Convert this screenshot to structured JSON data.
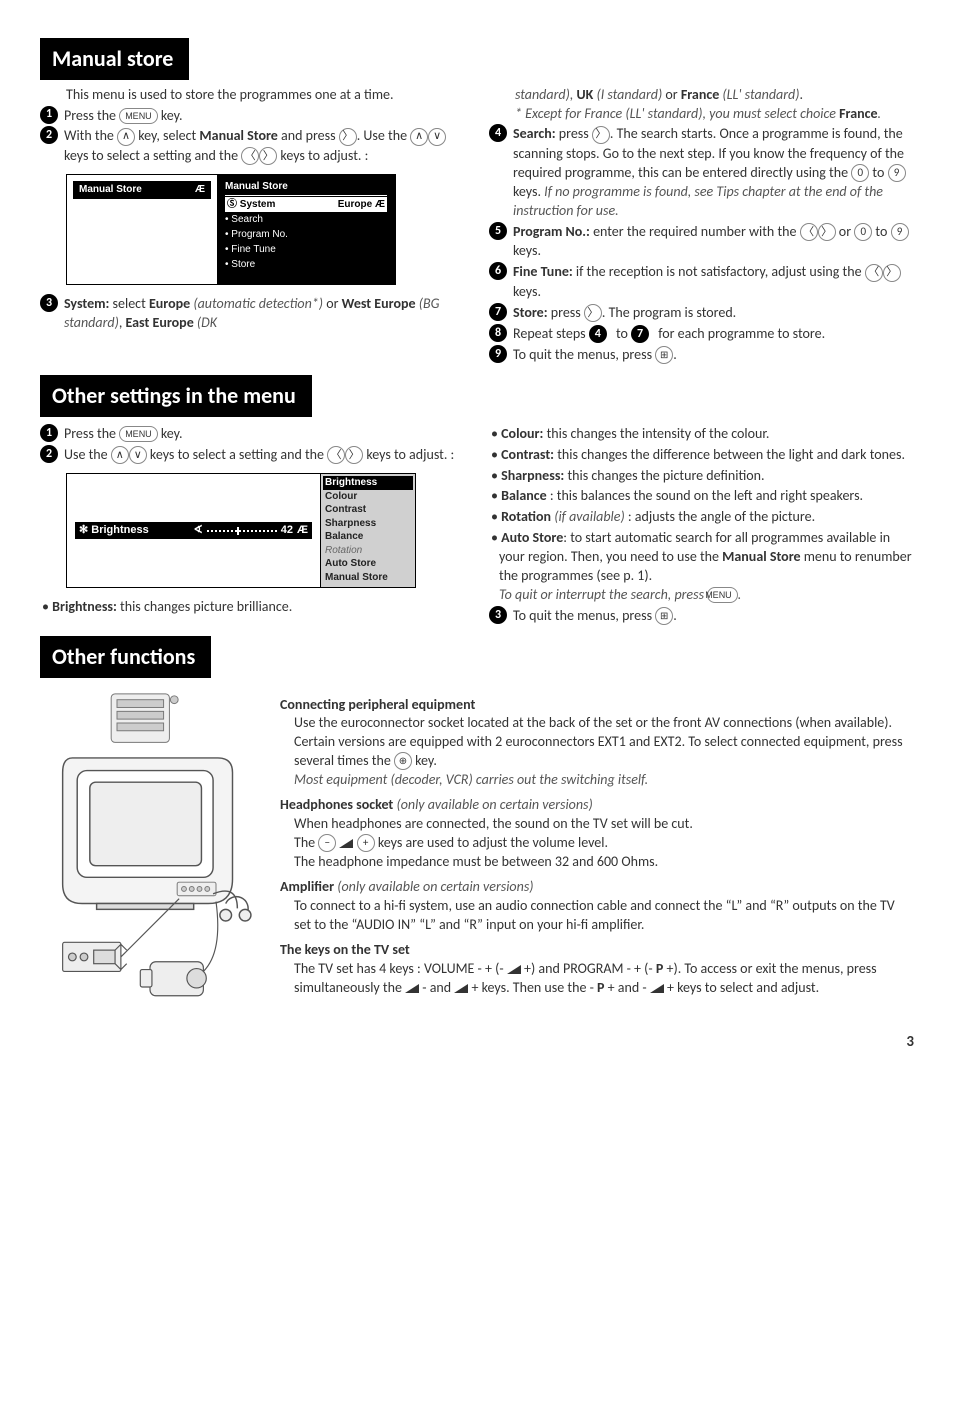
{
  "sections": {
    "manual": {
      "title": "Manual store",
      "intro": "This menu is used to store the programmes one at a time.",
      "step1": "Press the ",
      "step1_end": " key.",
      "step2a": "With the ",
      "step2b": " key, select ",
      "step2_bold": "Manual Store",
      "step2c": " and press ",
      "step2d": ". Use the ",
      "step2e": " keys to select a setting and the ",
      "step2f": " keys to adjust. :",
      "ui_left": "Manual Store",
      "ui_right_title": "Manual Store",
      "ui_right_sel": "Ⓢ System",
      "ui_right_sel_val": "Europe Æ",
      "ui_items": [
        "• Search",
        "• Program No.",
        "• Fine Tune",
        "• Store"
      ],
      "step3a": "System: ",
      "step3b": "select ",
      "step3_eu": "Europe",
      "step3_it1": "(automatic detection*)",
      "step3_or": " or ",
      "step3_we": "West Europe ",
      "step3_it2": "(BG standard)",
      "step3_comma": ", ",
      "step3_ee": "East Europe ",
      "step3_it3": "(DK ",
      "step3_right1": "standard), ",
      "step3_uk": "UK ",
      "step3_it4": "(I standard)",
      "step3_fr": "France ",
      "step3_it5": "(LL' standard)",
      "step3_dot": ".",
      "step3_note": "* Except for France (LL' standard), you must select choice ",
      "step3_note_b": "France",
      "step4a": "Search: ",
      "step4b": "press ",
      "step4c": ". The search starts. Once a programme is found, the scanning stops. Go to the next step. If you know the frequency of the required programme, this can be entered directly using the ",
      "step4d": " to ",
      "step4e": " keys. ",
      "step4_it": "If no programme is found, see Tips chapter at the end of the instruction for use.",
      "step5a": "Program No.: ",
      "step5b": "enter the required number with the ",
      "step5c": " or ",
      "step5d": " to ",
      "step5e": " keys.",
      "step6a": "Fine Tune: ",
      "step6b": "if the reception is not satisfactory, adjust using the ",
      "step6c": " keys.",
      "step7a": "Store: ",
      "step7b": "press ",
      "step7c": ". The program is stored.",
      "step8a": "Repeat steps ",
      "step8b": " to ",
      "step8c": " for each programme to store.",
      "step9a": "To quit the menus, press ",
      "step9b": "."
    },
    "other_settings": {
      "title": "Other settings in the menu",
      "step1": "Press the ",
      "step1_end": " key.",
      "step2a": "Use the ",
      "step2b": " keys to select a setting and the ",
      "step2c": " keys to adjust. :",
      "ui_left_label": "✻ Brightness",
      "ui_left_val": "42",
      "ui_right": [
        "Brightness",
        "Colour",
        "Contrast",
        "Sharpness",
        "Balance",
        "Rotation",
        "Auto Store",
        "Manual Store"
      ],
      "items": {
        "brightness": "Brightness: ",
        "brightness_t": "this changes picture brilliance.",
        "colour": "Colour: ",
        "colour_t": "this changes the intensity of the colour.",
        "contrast": "Contrast: ",
        "contrast_t": "this changes the difference between the light and dark tones.",
        "sharpness": "Sharpness: ",
        "sharpness_t": "this changes the picture definition.",
        "balance": "Balance ",
        "balance_t": ": this balances the sound on the left and right speakers.",
        "rotation": "Rotation ",
        "rotation_it": "(if available) ",
        "rotation_t": ": adjusts the angle of the picture.",
        "auto": "Auto Store",
        "auto_t": ": to start automatic search for all programmes available in your region. Then, you need to use the ",
        "auto_b": "Manual Store",
        "auto_t2": " menu to renumber the programmes (see p. 1).",
        "auto_it": "To quit or interrupt the search, press "
      },
      "step3a": "To quit the menus, press ",
      "step3b": "."
    },
    "other_func": {
      "title": "Other functions",
      "h1": "Connecting peripheral equipment",
      "p1a": "Use the euroconnector socket located at the back of the set or the front AV connections (when available). Certain versions are equipped with 2 euroconnectors EXT1 and EXT2. To select connected equipment, press several times the ",
      "p1b": " key.",
      "p1_it": "Most equipment (decoder, VCR) carries out the switching itself.",
      "h2": "Headphones socket ",
      "h2_it": "(only available on certain versions)",
      "p2a": "When headphones are connected, the sound on the TV set will be cut.",
      "p2b": "The ",
      "p2c": " keys are used to adjust the volume level.",
      "p2d": "The headphone impedance must be between 32 and 600 Ohms.",
      "h3": "Amplifier ",
      "h3_it": "(only available on certain versions)",
      "p3": "To connect to a hi-fi system, use an audio connection cable and connect the “L” and “R” outputs on the TV set to the “AUDIO IN” “L” and “R” input on your hi-fi amplifier.",
      "h4": "The keys on the TV set",
      "p4a": "The TV set has 4 keys : VOLUME - + (- ",
      "p4b": " +) and PROGRAM - + (- ",
      "p4c": " +). To access or exit the menus, press simultaneously the ",
      "p4d": " - and ",
      "p4e": " + keys. Then use the - ",
      "p4f": " + and - ",
      "p4g": " + keys to select and adjust."
    }
  },
  "keys": {
    "menu": "MENU",
    "up": "∧",
    "down": "∨",
    "left": "〈",
    "right": "〉",
    "zero": "0",
    "nine": "9",
    "quit": "⊞",
    "av": "⊕",
    "minus": "−",
    "plus": "+",
    "P": "P",
    "four": "4",
    "seven": "7"
  },
  "page": "3"
}
